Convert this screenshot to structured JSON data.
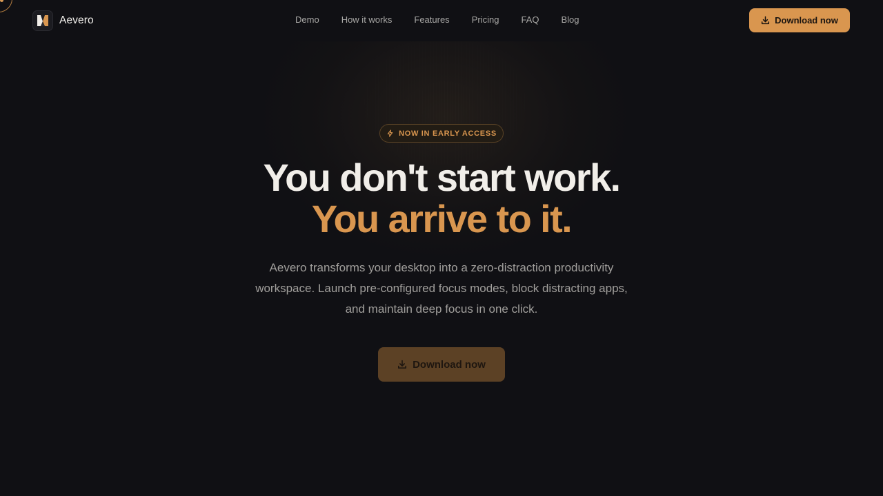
{
  "brand": {
    "name": "Aevero",
    "logo_icon": "aevero-logo-icon"
  },
  "nav": {
    "links": [
      "Demo",
      "How it works",
      "Features",
      "Pricing",
      "FAQ",
      "Blog"
    ],
    "cta_label": "Download now",
    "cta_icon": "download-icon"
  },
  "hero": {
    "badge_icon": "lightning-icon",
    "badge_text": "NOW IN EARLY ACCESS",
    "headline_line1": "You don't start work.",
    "headline_line2": "You arrive to it.",
    "description": "Aevero transforms your desktop into a zero-distraction productivity workspace. Launch pre-configured focus modes, block distracting apps, and maintain deep focus in one click.",
    "cta_label": "Download now",
    "cta_icon": "download-icon"
  },
  "colors": {
    "background": "#101014",
    "accent": "#d9964f",
    "headline": "#f1eee9",
    "muted_text": "#a19f9c"
  }
}
